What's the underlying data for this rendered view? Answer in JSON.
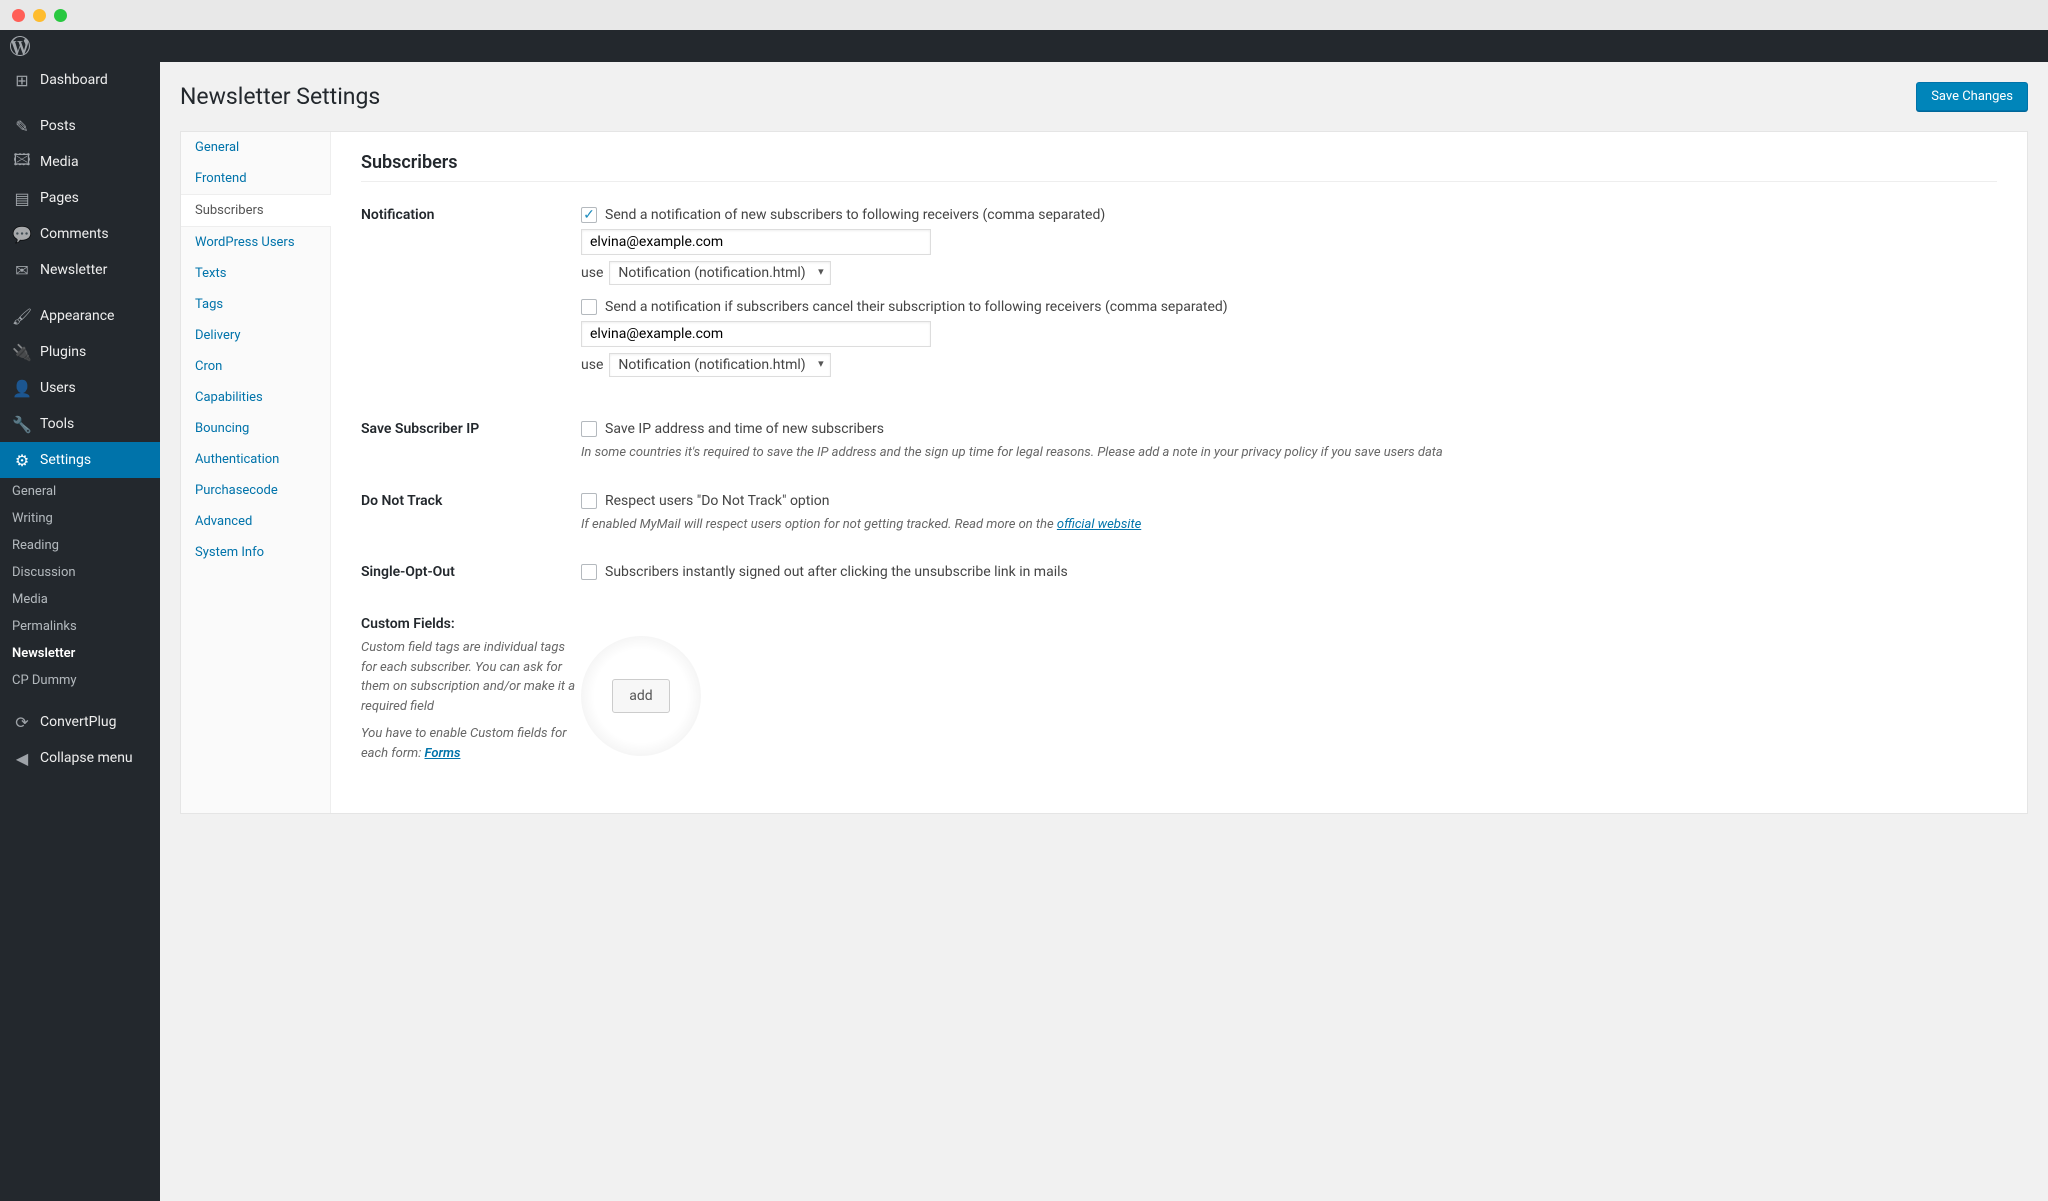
{
  "page": {
    "title": "Newsletter Settings",
    "save_btn": "Save Changes"
  },
  "sidebar": {
    "items": [
      {
        "id": "dashboard",
        "label": "Dashboard",
        "icon": "◧"
      },
      {
        "id": "posts",
        "label": "Posts",
        "icon": "📌"
      },
      {
        "id": "media",
        "label": "Media",
        "icon": "🖼"
      },
      {
        "id": "pages",
        "label": "Pages",
        "icon": "▤"
      },
      {
        "id": "comments",
        "label": "Comments",
        "icon": "💬"
      },
      {
        "id": "newsletter",
        "label": "Newsletter",
        "icon": "✉"
      },
      {
        "id": "appearance",
        "label": "Appearance",
        "icon": "🖌"
      },
      {
        "id": "plugins",
        "label": "Plugins",
        "icon": "🔌"
      },
      {
        "id": "users",
        "label": "Users",
        "icon": "👤"
      },
      {
        "id": "tools",
        "label": "Tools",
        "icon": "🔧"
      },
      {
        "id": "settings",
        "label": "Settings",
        "icon": "⚙"
      }
    ],
    "sub_settings": [
      "General",
      "Writing",
      "Reading",
      "Discussion",
      "Media",
      "Permalinks",
      "Newsletter",
      "CP Dummy"
    ],
    "sub_extra": [
      "ConvertPlug",
      "Collapse menu"
    ]
  },
  "vtabs": [
    "General",
    "Frontend",
    "Subscribers",
    "WordPress Users",
    "Texts",
    "Tags",
    "Delivery",
    "Cron",
    "Capabilities",
    "Bouncing",
    "Authentication",
    "Purchasecode",
    "Advanced",
    "System Info"
  ],
  "section": {
    "title": "Subscribers"
  },
  "fields": {
    "notification": {
      "label": "Notification",
      "check1": "Send a notification of new subscribers to following receivers (comma separated)",
      "email1": "elvina@example.com",
      "use": "use",
      "select1": "Notification (notification.html)",
      "check2": "Send a notification if subscribers cancel their subscription to following receivers (comma separated)",
      "email2": "elvina@example.com",
      "select2": "Notification (notification.html)"
    },
    "save_ip": {
      "label": "Save Subscriber IP",
      "check": "Save IP address and time of new subscribers",
      "desc": "In some countries it's required to save the IP address and the sign up time for legal reasons. Please add a note in your privacy policy if you save users data"
    },
    "dnt": {
      "label": "Do Not Track",
      "check": "Respect users \"Do Not Track\" option",
      "desc": "If enabled MyMail will respect users option for not getting tracked. Read more on the ",
      "link": "official website"
    },
    "single_opt_out": {
      "label": "Single-Opt-Out",
      "check": "Subscribers instantly signed out after clicking the unsubscribe link in mails"
    },
    "custom": {
      "label": "Custom Fields:",
      "desc1": "Custom field tags are individual tags for each subscriber. You can ask for them on subscription and/or make it a required field",
      "desc2a": "You have to enable Custom fields for each form: ",
      "desc2b": "Forms",
      "add_btn": "add"
    }
  }
}
